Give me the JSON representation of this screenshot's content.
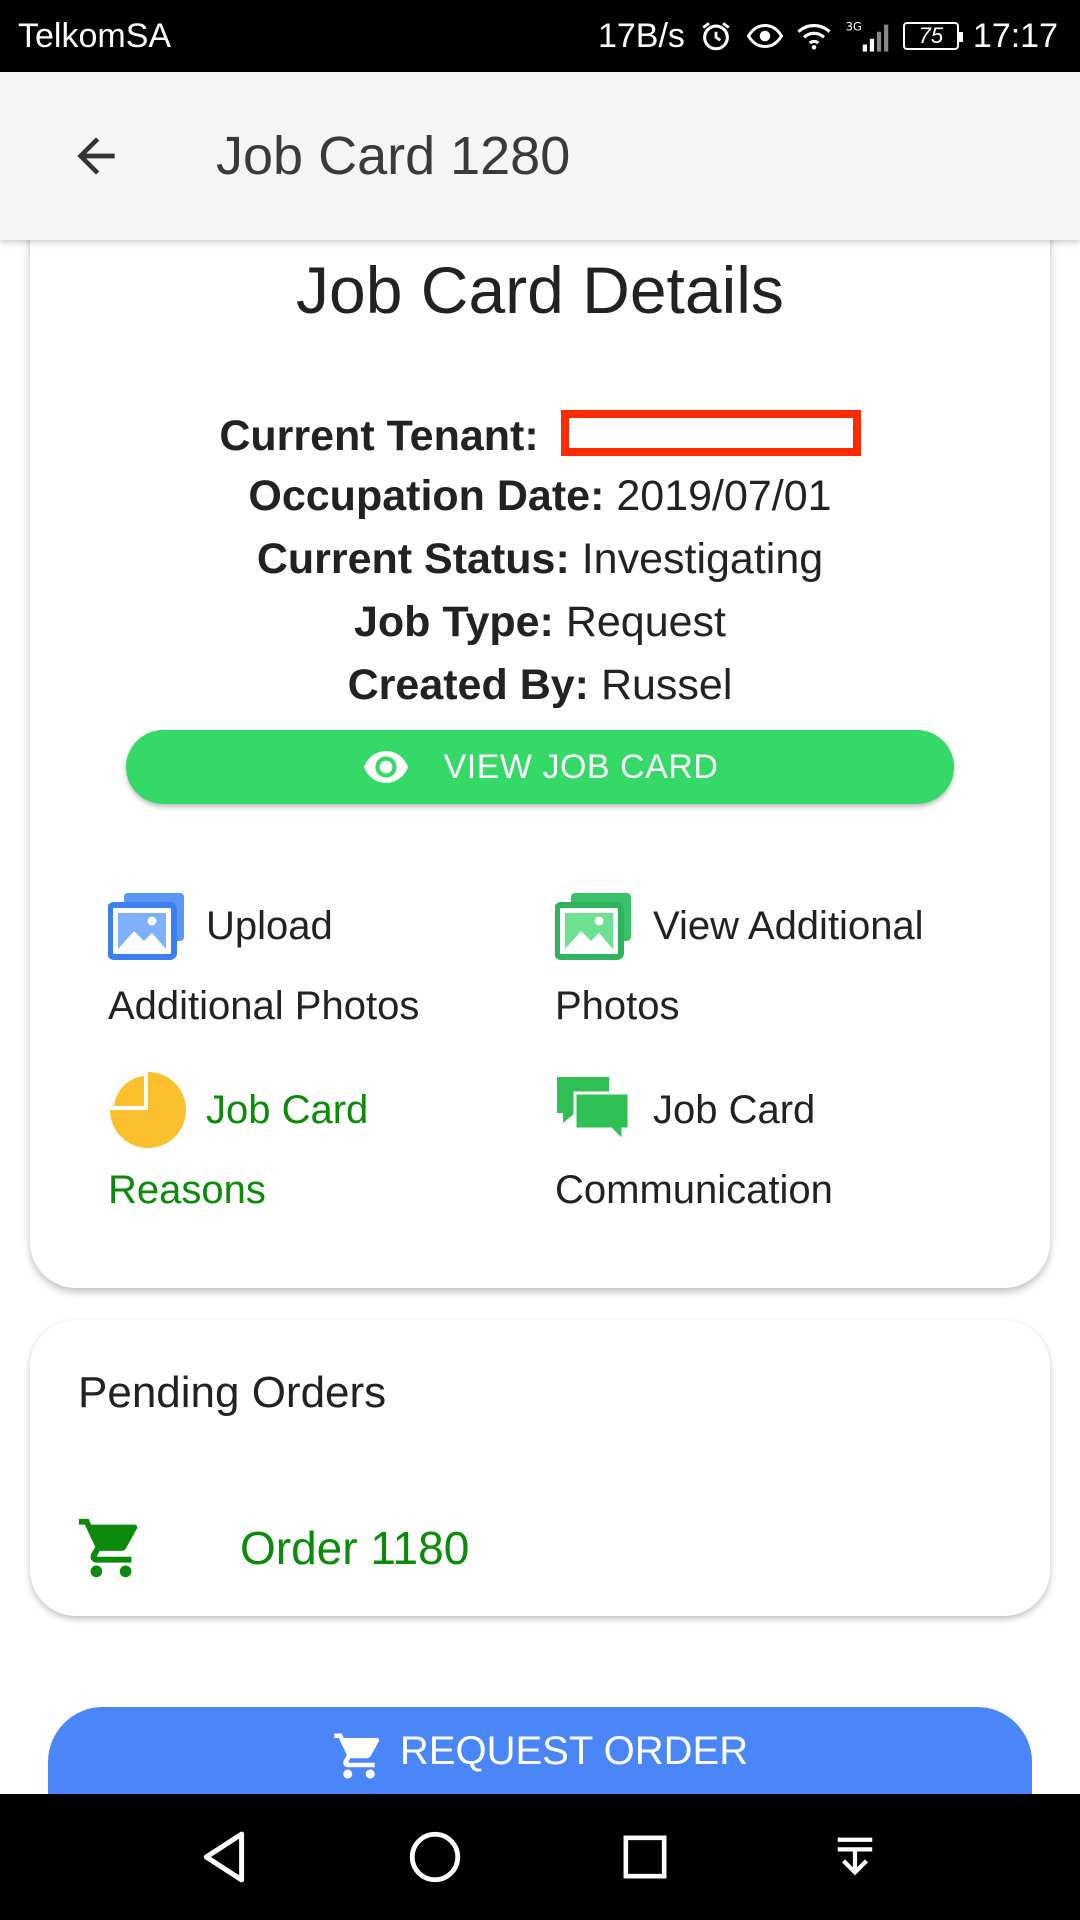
{
  "status_bar": {
    "carrier": "TelkomSA",
    "speed": "17B/s",
    "network": "3G",
    "battery": "75",
    "time": "17:17"
  },
  "app_bar": {
    "title": "Job Card 1280",
    "back_icon": "arrow-back-icon"
  },
  "details": {
    "title": "Job Card Details",
    "fields": [
      {
        "label": "Current Tenant:",
        "value": ""
      },
      {
        "label": "Occupation Date:",
        "value": "2019/07/01"
      },
      {
        "label": "Current Status:",
        "value": "Investigating"
      },
      {
        "label": "Job Type:",
        "value": "Request"
      },
      {
        "label": "Created By:",
        "value": "Russel"
      }
    ],
    "view_button": {
      "label": "VIEW JOB CARD",
      "icon": "eye-icon",
      "color": "#34d967"
    },
    "actions": {
      "upload_photos": {
        "line1": "Upload",
        "line2": "Additional Photos",
        "icon": "image-blue-icon"
      },
      "view_photos": {
        "line1": "View Additional",
        "line2": "Photos",
        "icon": "image-green-icon"
      },
      "reasons": {
        "line1": "Job Card",
        "line2": "Reasons",
        "icon": "pie-chart-icon"
      },
      "communication": {
        "line1": "Job Card",
        "line2": "Communication",
        "icon": "chat-icon"
      }
    }
  },
  "orders": {
    "title": "Pending Orders",
    "items": [
      {
        "label": "Order 1180",
        "icon": "cart-icon"
      }
    ]
  },
  "request_button": {
    "label": "REQUEST ORDER",
    "icon": "cart-icon",
    "color": "#4a86f7"
  },
  "nav": [
    "back-triangle-icon",
    "home-circle-icon",
    "recents-square-icon",
    "notification-pull-icon"
  ]
}
